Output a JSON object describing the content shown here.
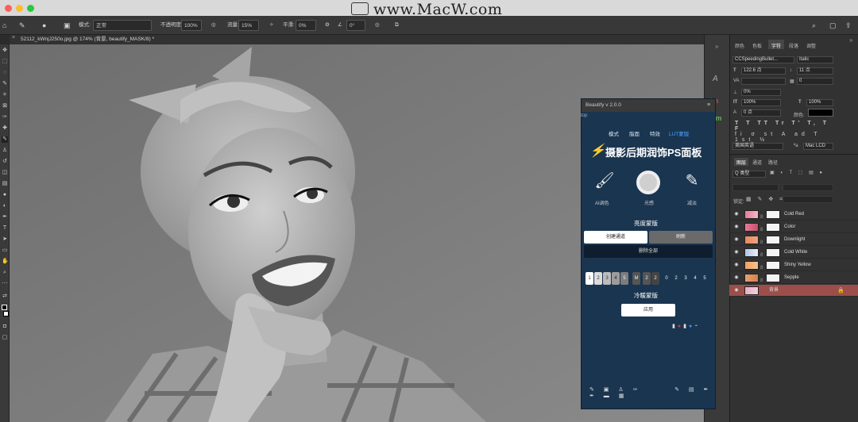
{
  "watermark": "www.MacW.com",
  "options_bar": {
    "mode_label": "模式:",
    "mode_value": "正常",
    "opacity_label": "不透明度:",
    "opacity_value": "100%",
    "flow_label": "流量:",
    "flow_value": "15%",
    "smoothing_label": "平滑:",
    "smoothing_value": "0%",
    "angle_value": "0°"
  },
  "document_tab": "52112_kWnjJ250o.jpg @ 174% (背景, beautify_MASK/8) *",
  "right_panel": {
    "top_tabs": [
      "颜色",
      "色板",
      "字符",
      "段落",
      "调整"
    ],
    "font_family": "CCSpeedingBullet...",
    "font_style": "Italic",
    "font_size": "122.6 点",
    "leading": "11 点",
    "tracking": "0",
    "baseline": "0%",
    "vscale": "100%",
    "hscale": "100%",
    "shift": "0 点",
    "color_label": "颜色:",
    "language": "美国英语",
    "aa_label": "ªa",
    "aa_value": "Mac LCD",
    "layers_tabs": [
      "图层",
      "通道",
      "路径"
    ],
    "kind_filter": "Q 类型",
    "lock_label": "锁定:",
    "layers": [
      {
        "name": "Cold Red"
      },
      {
        "name": "Color"
      },
      {
        "name": "Downlight"
      },
      {
        "name": "Cold White"
      },
      {
        "name": "Shiny Yellow"
      },
      {
        "name": "Sepple"
      },
      {
        "name": "背景"
      }
    ]
  },
  "plugin": {
    "title": "Beautify v 2.0.0",
    "tabs": [
      "模式",
      "脂面",
      "特效",
      "LUT蒙版"
    ],
    "brand_title": "摄影后期润饰PS面板",
    "tools": [
      {
        "label": "AI调色"
      },
      {
        "label": "光感"
      },
      {
        "label": "减淡"
      }
    ],
    "brightness_mask_title": "亮度蒙版",
    "create_channel": "创建通道",
    "refresh": "刷新",
    "delete_all": "删除全部",
    "numbers_left": [
      "1",
      "2",
      "3",
      "4",
      "5"
    ],
    "mid_label": "M",
    "numbers_mid": [
      "2",
      "2"
    ],
    "numbers_right": [
      "0",
      "2",
      "3",
      "4",
      "5"
    ],
    "cool_warm_title": "冷暖蒙版",
    "apply": "应用"
  },
  "colors": {
    "plugin_bg": "#1a3550",
    "accent_blue": "#4aa3ff",
    "selected_layer": "#9b4e4a"
  }
}
